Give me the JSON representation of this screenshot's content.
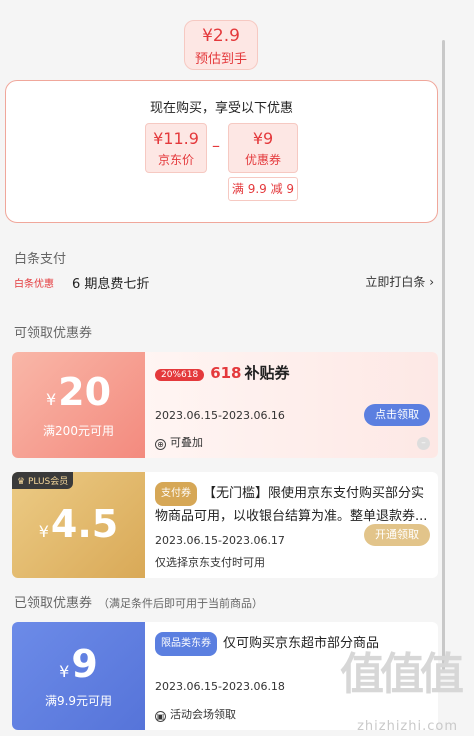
{
  "estimate": {
    "price": "¥2.9",
    "label": "预估到手"
  },
  "promo": {
    "header": "现在购买，享受以下优惠",
    "jd_price": {
      "value": "¥11.9",
      "label": "京东价"
    },
    "minus": "–",
    "coupon": {
      "value": "¥9",
      "label": "优惠券"
    },
    "rule": "满 9.9 减 9"
  },
  "baitiao": {
    "title": "白条支付",
    "tag": "白条优惠",
    "text": "6 期息费七折",
    "link": "立即打白条 ›"
  },
  "available": {
    "title": "可领取优惠券",
    "coupons": [
      {
        "amount": "20",
        "currency": "¥",
        "condition": "满200元可用",
        "badge": "20%618",
        "brand": "618",
        "name": "补贴券",
        "date": "2023.06.15-2023.06.16",
        "button": "点击领取",
        "foot": "可叠加"
      },
      {
        "amount": "4.5",
        "currency": "¥",
        "corner": "PLUS会员",
        "tag": "支付券",
        "title": "【无门槛】限使用京东支付购买部分实物商品可用，以收银台结算为准。整单退款券...",
        "date": "2023.06.15-2023.06.17",
        "button": "开通领取",
        "foot": "仅选择京东支付时可用"
      }
    ]
  },
  "claimed": {
    "title": "已领取优惠券",
    "note": "（满足条件后即可用于当前商品）",
    "coupons": [
      {
        "amount": "9",
        "currency": "¥",
        "condition": "满9.9元可用",
        "tag": "限品类东券",
        "title": "仅可购买京东超市部分商品",
        "date": "2023.06.15-2023.06.18",
        "foot": "活动会场领取"
      }
    ]
  },
  "watermark": "zhizhizhi.com",
  "watermark_logo": "值值值",
  "colors": {
    "accent": "#e4393c",
    "blue_btn": "#5b7fe0",
    "gold": "#d6a756"
  }
}
